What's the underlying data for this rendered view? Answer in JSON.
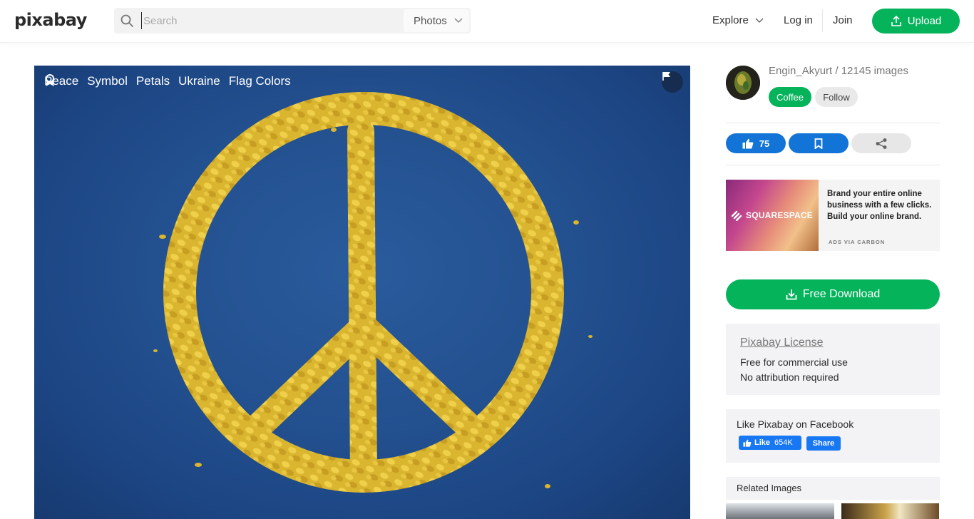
{
  "header": {
    "logo": "pixabay",
    "search_placeholder": "Search",
    "search_value": "",
    "media_type": "Photos",
    "explore": "Explore",
    "login": "Log in",
    "join": "Join",
    "upload": "Upload"
  },
  "image": {
    "tags": [
      "Peace",
      "Symbol",
      "Petals",
      "Ukraine",
      "Flag Colors"
    ]
  },
  "author": {
    "line": "Engin_Akyurt / 12145 images",
    "coffee": "Coffee",
    "follow": "Follow"
  },
  "actions": {
    "likes": "75"
  },
  "ad": {
    "brand": "SQUARESPACE",
    "text": "Brand your entire online business with a few clicks. Build your online brand.",
    "via": "ADS VIA CARBON"
  },
  "download": {
    "label": "Free Download"
  },
  "license": {
    "title": "Pixabay License",
    "line1": "Free for commercial use",
    "line2": "No attribution required"
  },
  "facebook": {
    "title": "Like Pixabay on Facebook",
    "like": "Like",
    "count": "654K",
    "share": "Share"
  },
  "related": {
    "title": "Related Images"
  },
  "colors": {
    "accent_green": "#05b35b",
    "action_blue": "#1174d6",
    "facebook_blue": "#1877f2",
    "photo_background": "#23508f",
    "petal_yellow": "#e2c23a"
  }
}
